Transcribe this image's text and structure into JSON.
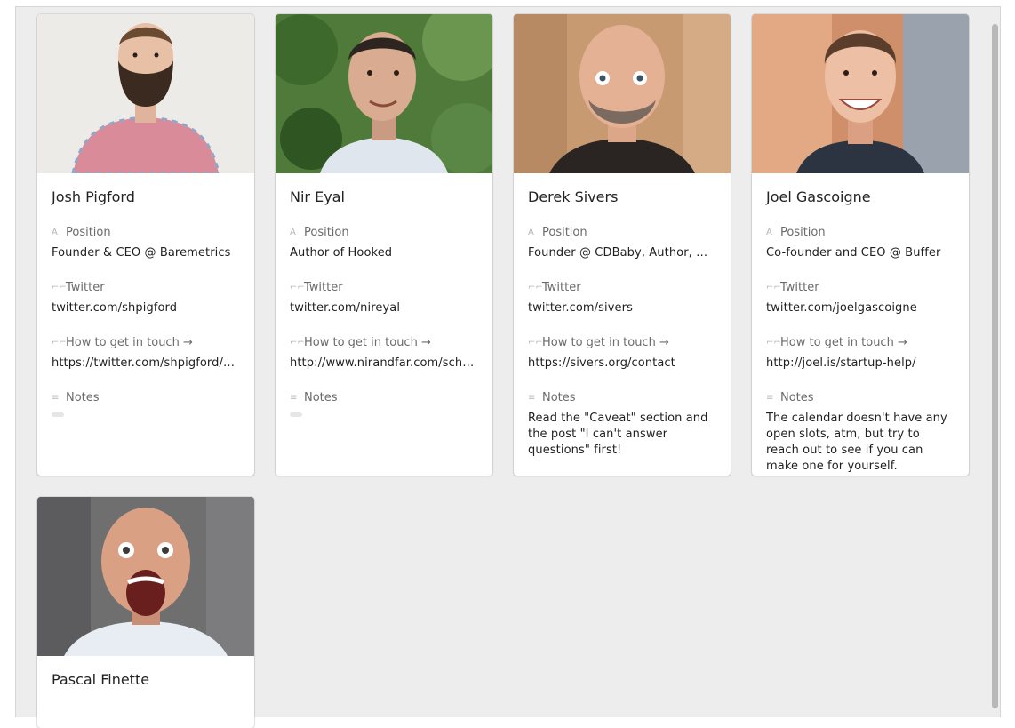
{
  "gallery": {
    "field_labels": {
      "position": "Position",
      "twitter": "Twitter",
      "contact": "How to get in touch →",
      "notes": "Notes"
    },
    "field_icons": {
      "position": "text-field-icon",
      "twitter": "url-field-icon",
      "contact": "url-field-icon",
      "notes": "long-text-field-icon"
    },
    "cards": [
      {
        "name": "Josh Pigford",
        "position": "Founder & CEO @ Baremetrics",
        "twitter": "twitter.com/shpigford",
        "contact": "https://twitter.com/shpigford/status/…",
        "notes": ""
      },
      {
        "name": "Nir Eyal",
        "position": "Author of Hooked",
        "twitter": "twitter.com/nireyal",
        "contact": "http://www.nirandfar.com/schedule",
        "notes": ""
      },
      {
        "name": "Derek Sivers",
        "position": "Founder @ CDBaby, Author, Musician",
        "twitter": "twitter.com/sivers",
        "contact": "https://sivers.org/contact",
        "notes": "Read the \"Caveat\" section and the post \"I can't answer questions\" first!"
      },
      {
        "name": "Joel Gascoigne",
        "position": "Co-founder and CEO @ Buffer",
        "twitter": "twitter.com/joelgascoigne",
        "contact": "http://joel.is/startup-help/",
        "notes": "The calendar doesn't have any open slots, atm, but try to reach out to see if you can make one for yourself."
      },
      {
        "name": "Pascal Finette"
      }
    ]
  }
}
